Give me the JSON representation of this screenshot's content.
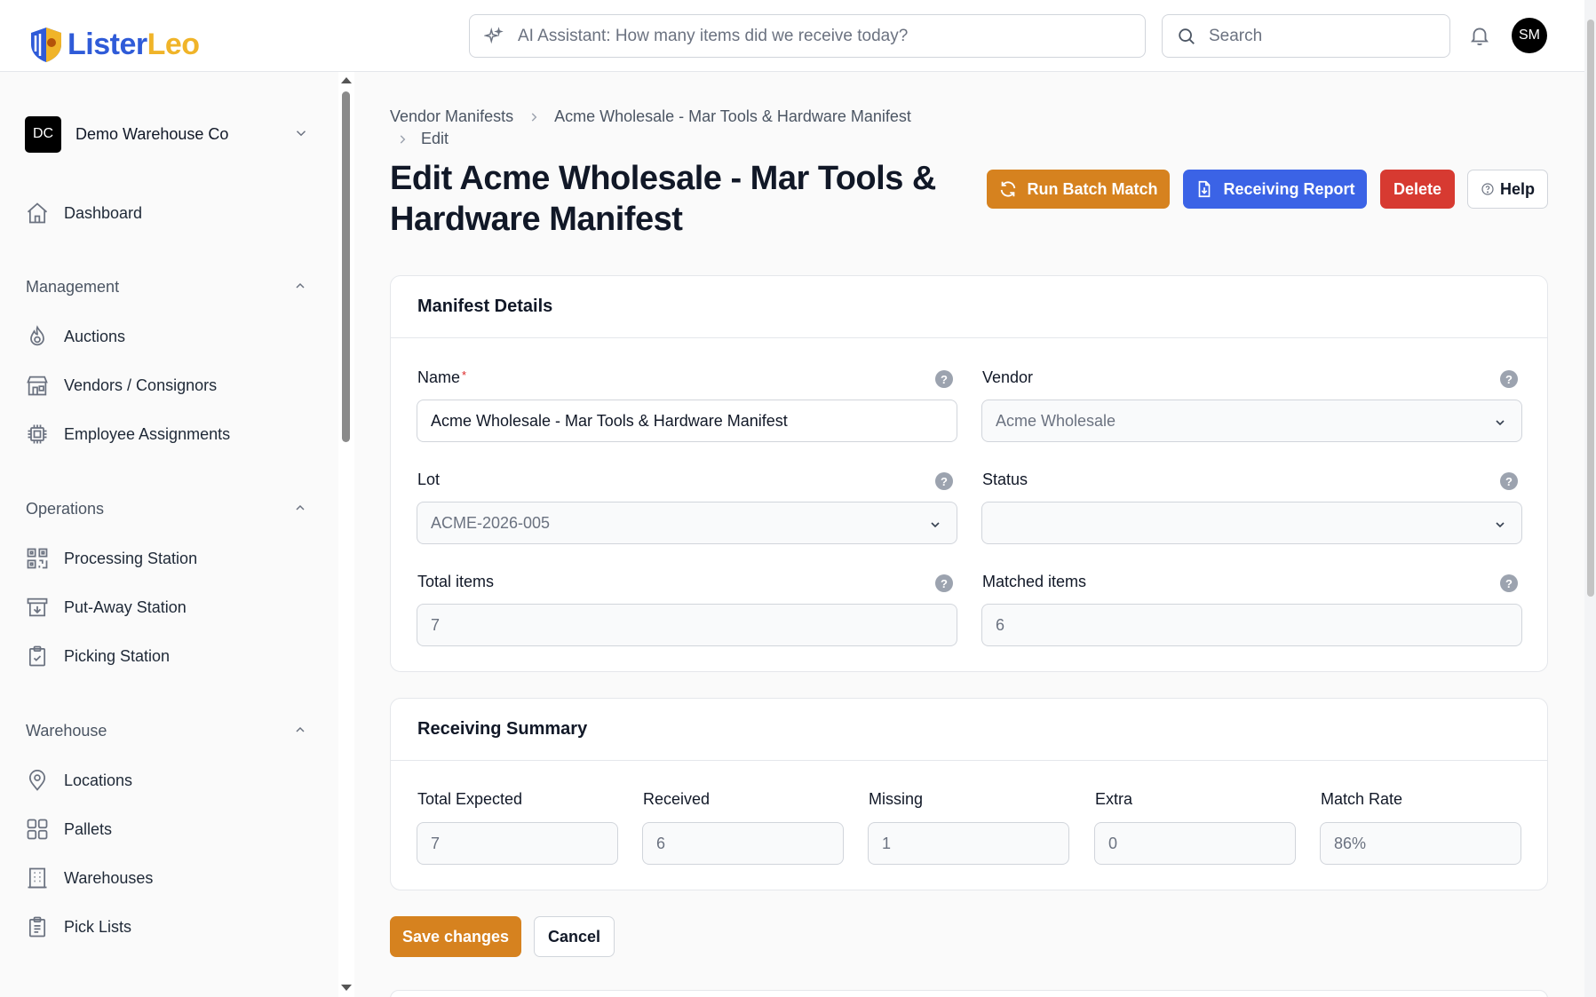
{
  "brand": {
    "part1": "Lister",
    "part2": "Leo",
    "color_primary": "#2f5bd8",
    "color_accent": "#f0b429"
  },
  "topbar": {
    "ai_placeholder": "AI Assistant: How many items did we receive today?",
    "search_placeholder": "Search",
    "avatar_initials": "SM"
  },
  "sidebar": {
    "org": {
      "initials": "DC",
      "name": "Demo Warehouse Co"
    },
    "dashboard": "Dashboard",
    "sections": [
      {
        "title": "Management",
        "items": [
          "Auctions",
          "Vendors / Consignors",
          "Employee Assignments"
        ]
      },
      {
        "title": "Operations",
        "items": [
          "Processing Station",
          "Put-Away Station",
          "Picking Station"
        ]
      },
      {
        "title": "Warehouse",
        "items": [
          "Locations",
          "Pallets",
          "Warehouses",
          "Pick Lists"
        ]
      }
    ]
  },
  "breadcrumb": {
    "level1": "Vendor Manifests",
    "level2": "Acme Wholesale - Mar Tools & Hardware Manifest",
    "level3": "Edit"
  },
  "page": {
    "title": "Edit Acme Wholesale - Mar Tools & Hardware Manifest"
  },
  "actions": {
    "batch_match": "Run Batch Match",
    "receiving_report": "Receiving Report",
    "delete": "Delete",
    "help": "Help",
    "color_batch": "#d6821f",
    "color_report": "#3b63e6",
    "color_delete": "#d73a31"
  },
  "manifest": {
    "header": "Manifest Details",
    "name_label": "Name",
    "name_value": "Acme Wholesale - Mar Tools & Hardware Manifest",
    "vendor_label": "Vendor",
    "vendor_value": "Acme Wholesale",
    "lot_label": "Lot",
    "lot_value": "ACME-2026-005",
    "status_label": "Status",
    "status_value": "",
    "total_items_label": "Total items",
    "total_items_value": "7",
    "matched_items_label": "Matched items",
    "matched_items_value": "6"
  },
  "summary": {
    "header": "Receiving Summary",
    "fields": [
      {
        "label": "Total Expected",
        "value": "7"
      },
      {
        "label": "Received",
        "value": "6"
      },
      {
        "label": "Missing",
        "value": "1"
      },
      {
        "label": "Extra",
        "value": "0"
      },
      {
        "label": "Match Rate",
        "value": "86%"
      }
    ]
  },
  "form": {
    "save": "Save changes",
    "cancel": "Cancel"
  }
}
